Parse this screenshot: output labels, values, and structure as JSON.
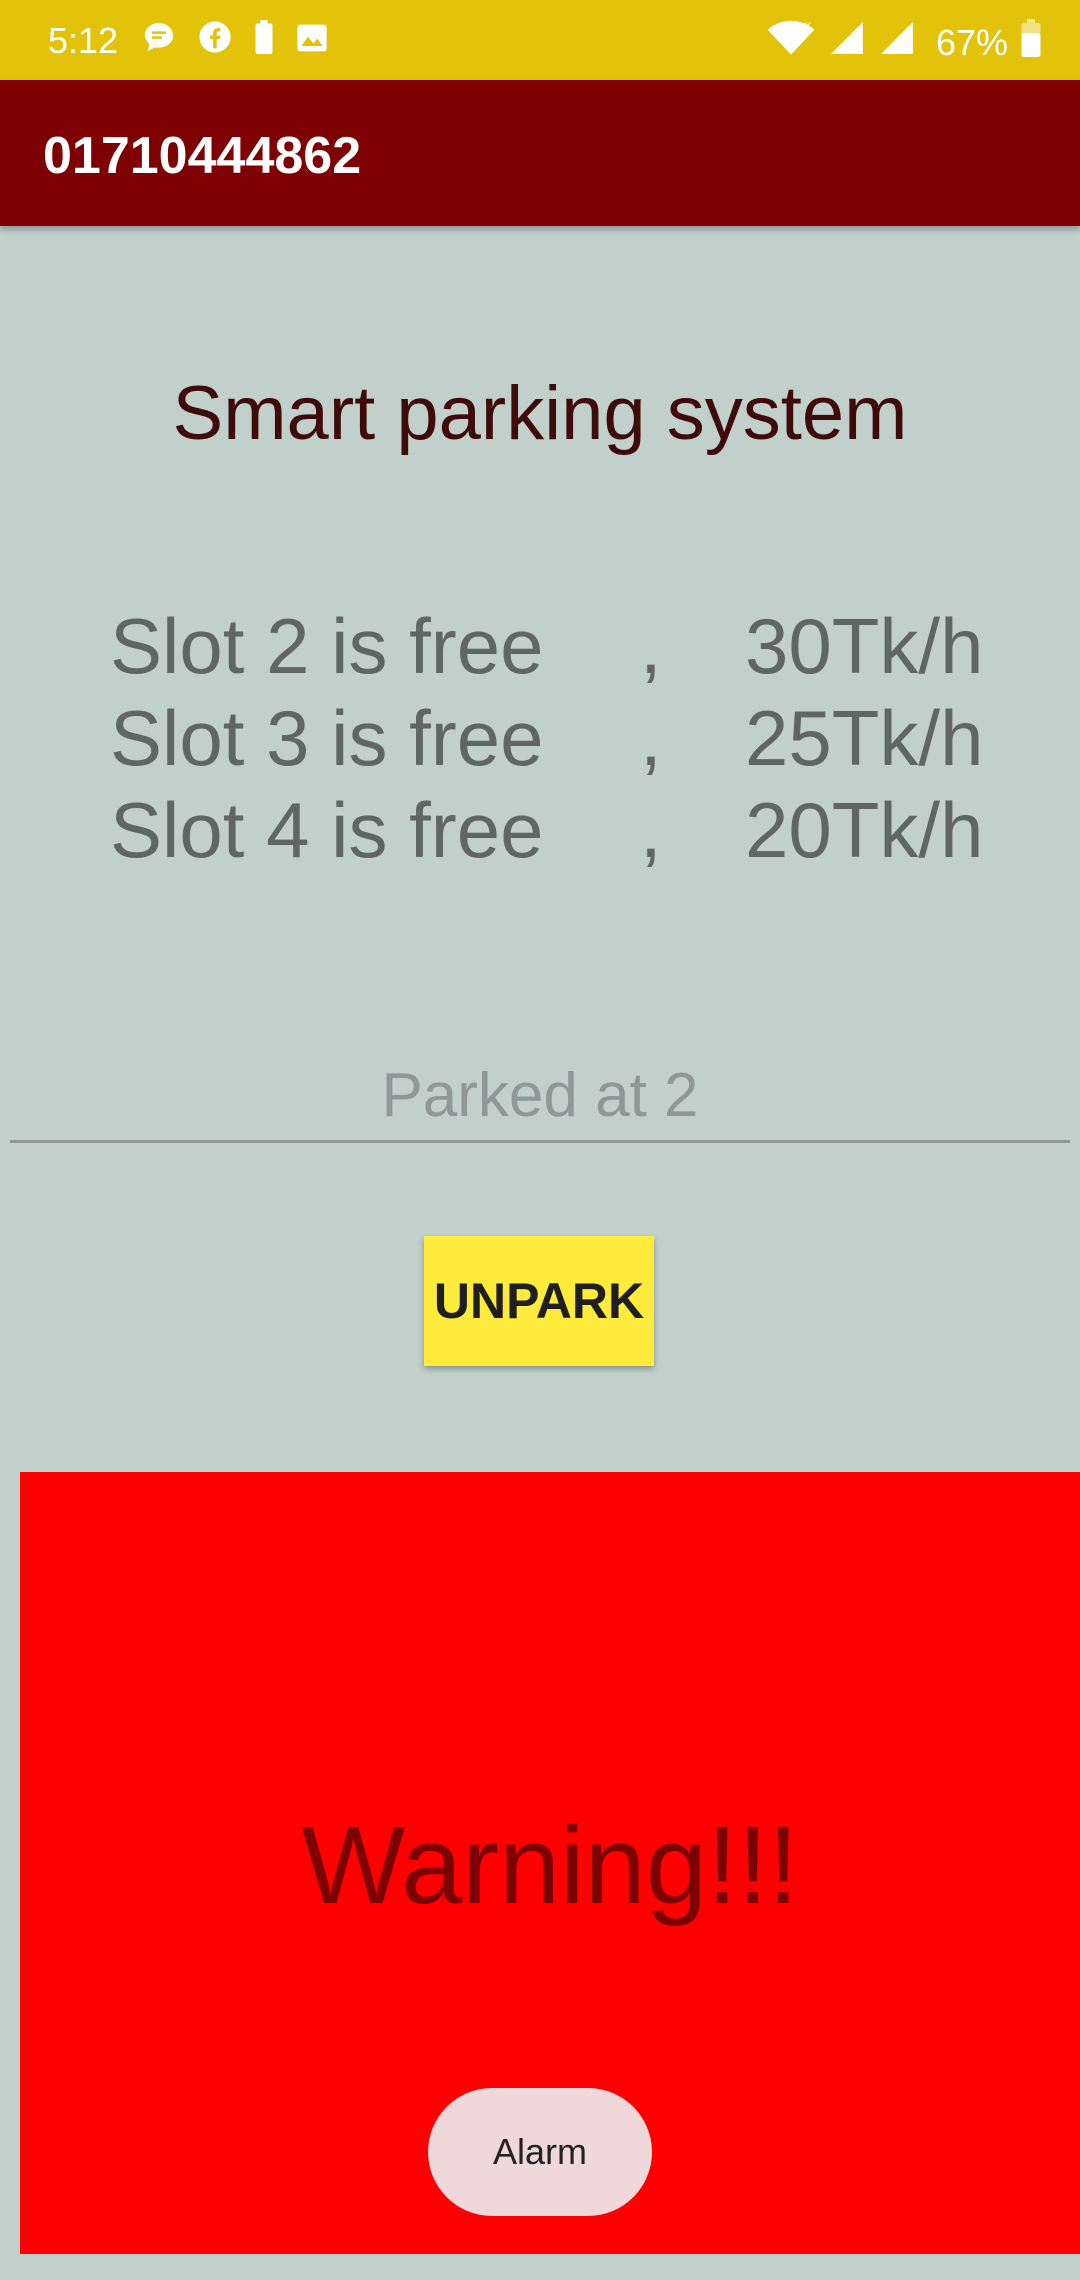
{
  "status_bar": {
    "time": "5:12",
    "battery_percent": "67%",
    "icons_left": [
      "chat-bubble-icon",
      "facebook-icon",
      "battery-saver-icon",
      "image-icon"
    ],
    "icons_right": [
      "wifi-icon",
      "signal-icon",
      "signal-icon",
      "battery-icon"
    ]
  },
  "app_bar": {
    "title": "01710444862"
  },
  "main": {
    "heading": "Smart parking system",
    "slots": [
      {
        "status": "Slot 2 is free",
        "separator": ",",
        "rate": "30Tk/h"
      },
      {
        "status": "Slot 3 is free",
        "separator": ",",
        "rate": "25Tk/h"
      },
      {
        "status": "Slot 4 is free",
        "separator": ",",
        "rate": "20Tk/h"
      }
    ],
    "parked_field": {
      "placeholder": "Parked at 2"
    },
    "unpark_button": "UNPARK"
  },
  "warning": {
    "text": "Warning!!!",
    "alarm_button": "Alarm"
  },
  "colors": {
    "status_bar": "#e2c30a",
    "app_bar": "#7e0103",
    "background": "#c2d0cc",
    "unpark_button": "#ffeb3b",
    "warning_panel": "#fe0000"
  }
}
